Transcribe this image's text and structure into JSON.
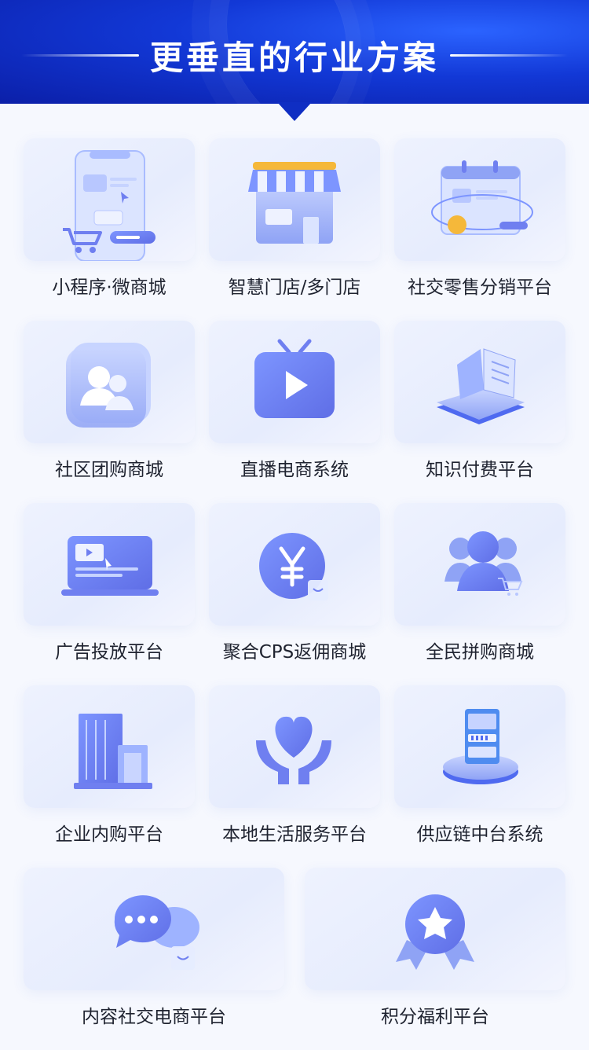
{
  "header": {
    "title": "更垂直的行业方案"
  },
  "items": [
    {
      "label": "小程序·微商城",
      "icon": "mini-program-phone-icon"
    },
    {
      "label": "智慧门店/多门店",
      "icon": "store-icon"
    },
    {
      "label": "社交零售分销平台",
      "icon": "calendar-browser-icon"
    },
    {
      "label": "社区团购商城",
      "icon": "community-users-icon"
    },
    {
      "label": "直播电商系统",
      "icon": "tv-play-icon"
    },
    {
      "label": "知识付费平台",
      "icon": "open-book-icon"
    },
    {
      "label": "广告投放平台",
      "icon": "laptop-video-icon"
    },
    {
      "label": "聚合CPS返佣商城",
      "icon": "yen-coin-icon"
    },
    {
      "label": "全民拼购商城",
      "icon": "group-people-cart-icon"
    },
    {
      "label": "企业内购平台",
      "icon": "office-building-icon"
    },
    {
      "label": "本地生活服务平台",
      "icon": "heart-hands-icon"
    },
    {
      "label": "供应链中台系统",
      "icon": "server-platform-icon"
    },
    {
      "label": "内容社交电商平台",
      "icon": "chat-bubbles-icon"
    },
    {
      "label": "积分福利平台",
      "icon": "star-medal-icon"
    }
  ],
  "colors": {
    "banner": "#1238d6",
    "accent": "#6f8cf6",
    "accent_light": "#a9bcff",
    "text": "#1f2330"
  }
}
